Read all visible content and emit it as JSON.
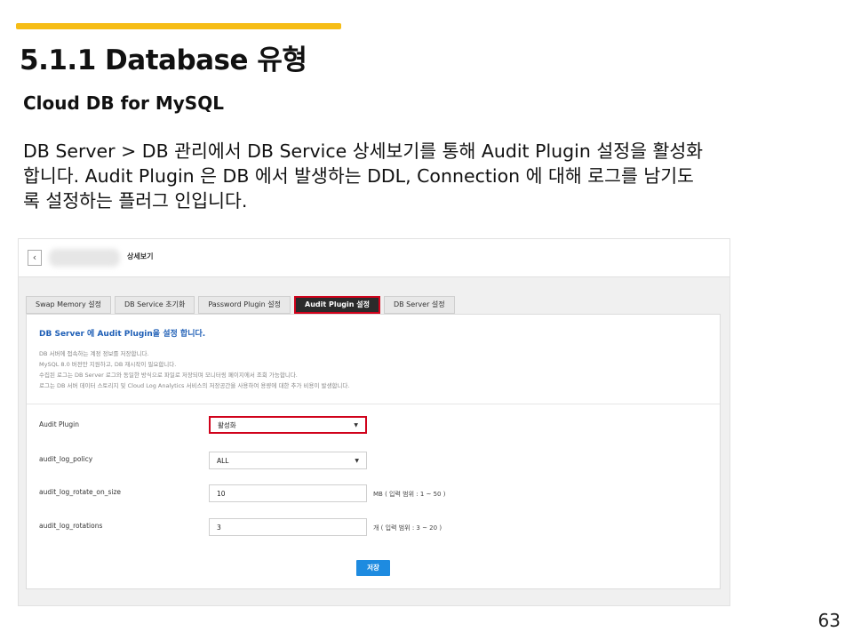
{
  "slide": {
    "title": "5.1.1 Database 유형",
    "subheading": "Cloud DB for MySQL",
    "paragraph_lines": [
      "DB Server > DB 관리에서 DB Service 상세보기를 통해 Audit Plugin 설정을 활성화",
      "합니다. Audit Plugin 은 DB 에서 발생하는 DDL, Connection 에 대해 로그를 남기도",
      "록 설정하는 플러그 인입니다."
    ],
    "page_number": "63"
  },
  "screenshot": {
    "header": {
      "back_icon": "chevron-left-icon",
      "back_glyph": "‹",
      "title": "상세보기"
    },
    "tabs": [
      {
        "label": "Swap Memory 설정",
        "active": false
      },
      {
        "label": "DB Service 초기화",
        "active": false
      },
      {
        "label": "Password Plugin 설정",
        "active": false
      },
      {
        "label": "Audit Plugin 설정",
        "active": true
      },
      {
        "label": "DB Server 설정",
        "active": false
      }
    ],
    "info": {
      "title": "DB Server 에 Audit Plugin을 설정 합니다.",
      "lines": [
        "DB 서버에 접속하는 계정 정보를 저장합니다.",
        "MySQL 8.0 버전만 지원하고, DB 재시작이 필요합니다.",
        "수집된 로그는 DB Server 로그와 동일한 방식으로 파일로 저장되며 모니터링 페이지에서 조회 가능합니다.",
        "로그는 DB 서버 데이터 스토리지 및 Cloud Log Analytics 서비스의 저장공간을 사용하여 용량에 대한 추가 비용이 발생합니다."
      ]
    },
    "fields": [
      {
        "label": "Audit Plugin",
        "value": "활성화",
        "type": "select",
        "suffix": ""
      },
      {
        "label": "audit_log_policy",
        "value": "ALL",
        "type": "select",
        "suffix": ""
      },
      {
        "label": "audit_log_rotate_on_size",
        "value": "10",
        "type": "input",
        "suffix": "MB ( 입력 범위 : 1 ~ 50 )"
      },
      {
        "label": "audit_log_rotations",
        "value": "3",
        "type": "input",
        "suffix": "개 ( 입력 범위 : 3 ~ 20 )"
      }
    ],
    "caret_glyph": "▼",
    "save_label": "저장"
  },
  "colors": {
    "accent_bar": "#f6bd16",
    "highlight_border": "#d0021b",
    "save_button": "#1e8be0",
    "info_title": "#1f5fb6"
  }
}
